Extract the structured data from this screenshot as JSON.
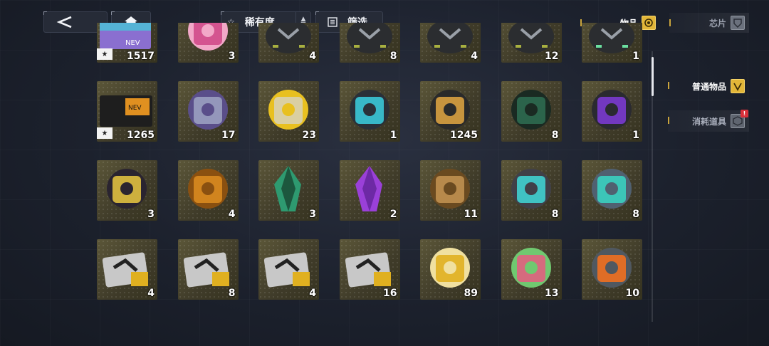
{
  "top": {
    "back_icon": "chevron-left-icon",
    "home_icon": "home-icon",
    "sort_label": "稀有度",
    "filter_label": "筛选"
  },
  "tabs": {
    "items_label": "物品",
    "chips_label": "芯片"
  },
  "side": {
    "normal_label": "普通物品",
    "consumable_label": "消耗道具",
    "consumable_badge": "!"
  },
  "colors": {
    "accent": "#e2b638",
    "cell_bg": "#4a4630",
    "background": "#1c212d"
  },
  "items": [
    {
      "icon": "neon-card-pack-icon",
      "qty": "1517"
    },
    {
      "icon": "heart-gift-box-icon",
      "qty": "3"
    },
    {
      "icon": "dark-emblem-capsule-icon",
      "qty": "4"
    },
    {
      "icon": "dark-x-emblem-capsule-icon",
      "qty": "8"
    },
    {
      "icon": "dark-wing-emblem-capsule-icon",
      "qty": "4"
    },
    {
      "icon": "dark-star-emblem-capsule-icon",
      "qty": "12"
    },
    {
      "icon": "dark-v-emblem-capsule-icon",
      "qty": "1"
    },
    {
      "icon": "gold-neon-card-icon",
      "qty": "1265"
    },
    {
      "icon": "holo-frame-card-icon",
      "qty": "17"
    },
    {
      "icon": "triangle-lock-icon",
      "qty": "23"
    },
    {
      "icon": "cyan-core-disc-icon",
      "qty": "1"
    },
    {
      "icon": "shield-ticket-icon",
      "qty": "1245"
    },
    {
      "icon": "green-supply-bag-icon",
      "qty": "8"
    },
    {
      "icon": "purple-orb-device-icon",
      "qty": "1"
    },
    {
      "icon": "lantern-icon",
      "qty": "3"
    },
    {
      "icon": "gold-bars-icon",
      "qty": "4"
    },
    {
      "icon": "green-crystal-icon",
      "qty": "3"
    },
    {
      "icon": "purple-crystal-icon",
      "qty": "2"
    },
    {
      "icon": "gold-capsule-icon",
      "qty": "11"
    },
    {
      "icon": "cyan-battery-icon",
      "qty": "8"
    },
    {
      "icon": "crystal-injector-icon",
      "qty": "8"
    },
    {
      "icon": "emblem-chip-a-icon",
      "qty": "4"
    },
    {
      "icon": "emblem-chip-b-icon",
      "qty": "8"
    },
    {
      "icon": "emblem-chip-c-icon",
      "qty": "4"
    },
    {
      "icon": "emblem-chip-d-icon",
      "qty": "16"
    },
    {
      "icon": "gold-ticket-icon",
      "qty": "89"
    },
    {
      "icon": "dango-plate-icon",
      "qty": "13"
    },
    {
      "icon": "disc-tool-icon",
      "qty": "10"
    }
  ]
}
